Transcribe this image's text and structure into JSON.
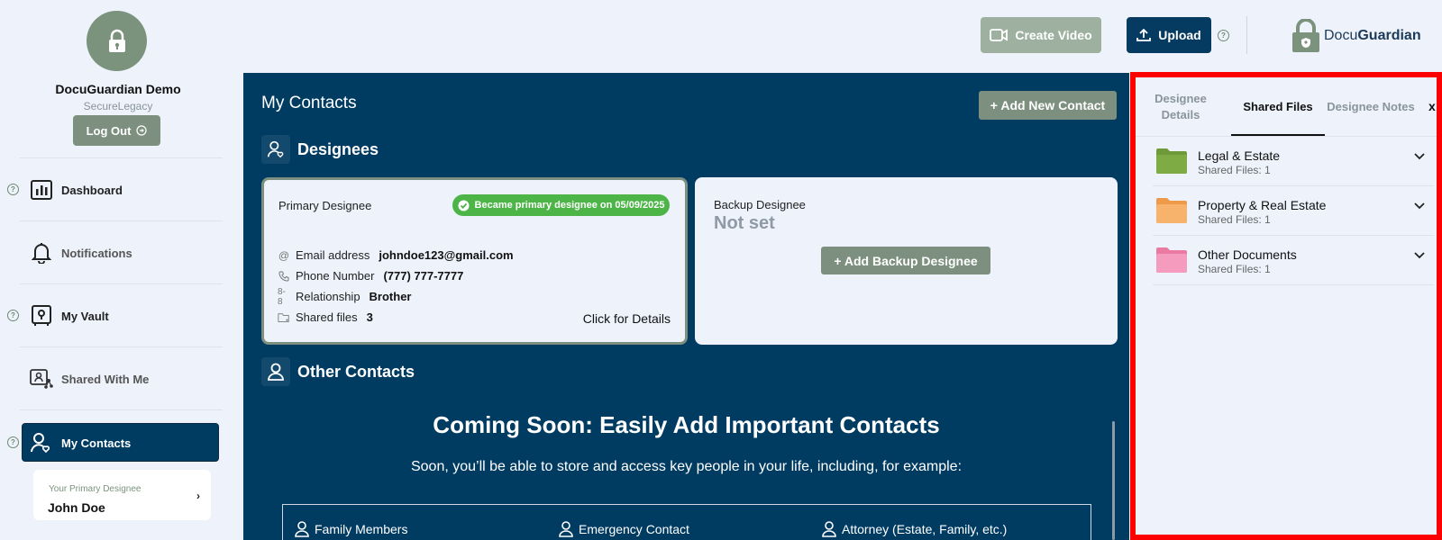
{
  "user": {
    "name": "DocuGuardian Demo",
    "org": "SecureLegacy",
    "logout_label": "Log Out"
  },
  "nav": {
    "items": [
      {
        "label": "Dashboard",
        "icon": "chart-icon"
      },
      {
        "label": "Notifications",
        "icon": "bell-icon"
      },
      {
        "label": "My Vault",
        "icon": "vault-icon"
      },
      {
        "label": "Shared With Me",
        "icon": "shared-icon"
      },
      {
        "label": "My Contacts",
        "icon": "contacts-icon"
      }
    ]
  },
  "primary_designee_card": {
    "label": "Your Primary Designee",
    "name": "John Doe"
  },
  "header": {
    "create_video_label": "Create Video",
    "upload_label": "Upload",
    "brand_prefix": "Docu",
    "brand_suffix": "Guardian"
  },
  "main": {
    "title": "My Contacts",
    "add_contact_label": "+ Add New Contact",
    "designees_heading": "Designees",
    "primary": {
      "label": "Primary Designee",
      "badge": "Became primary designee on 05/09/2025",
      "email_label": "Email address",
      "email": "johndoe123@gmail.com",
      "phone_label": "Phone Number",
      "phone": "(777) 777-7777",
      "relationship_label": "Relationship",
      "relationship": "Brother",
      "shared_label": "Shared files",
      "shared_count": "3",
      "details_label": "Click for Details"
    },
    "backup": {
      "label": "Backup Designee",
      "value": "Not set",
      "add_label": "+ Add Backup Designee"
    },
    "other_heading": "Other Contacts",
    "coming_title": "Coming Soon: Easily Add Important Contacts",
    "coming_sub": "Soon, you’ll be able to store and access key people in your life, including, for example:",
    "contact_types": [
      "Family Members",
      "Emergency Contact",
      "Attorney (Estate, Family, etc.)"
    ]
  },
  "panel": {
    "tabs": [
      "Designee Details",
      "Shared Files",
      "Designee Notes"
    ],
    "active_tab": "Shared Files",
    "close_label": "x",
    "folders": [
      {
        "name": "Legal & Estate",
        "count": "Shared Files: 1",
        "color": "#6f9a39"
      },
      {
        "name": "Property & Real Estate",
        "count": "Shared Files: 1",
        "color": "#f4a85a"
      },
      {
        "name": "Other Documents",
        "count": "Shared Files: 1",
        "color": "#f28ab0"
      }
    ]
  },
  "colors": {
    "navy": "#003b62",
    "sage": "#7d907f",
    "badge_green": "#4db548",
    "highlight": "#ff0000"
  }
}
